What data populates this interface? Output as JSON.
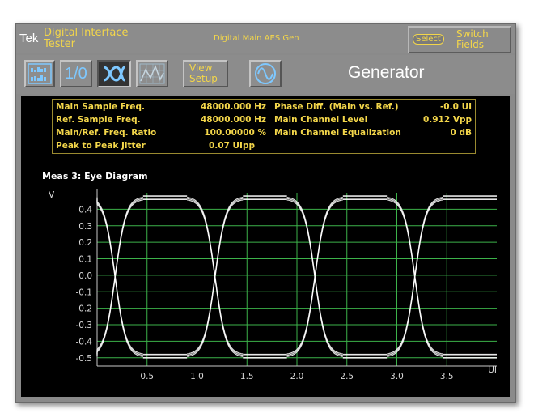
{
  "header": {
    "brand": "Tek",
    "app_title_line1": "Digital Interface",
    "app_title_line2": "Tester",
    "mode": "Digital Main AES Gen",
    "select_chip": "Select",
    "switch_line1": "Switch",
    "switch_line2": "Fields"
  },
  "toolbar": {
    "io_label": "1/0",
    "view_line1": "View",
    "view_line2": "Setup",
    "title": "Generator",
    "icons": [
      "bar-meter-icon",
      "io-icon",
      "eye-diagram-icon",
      "graph-icon",
      "view-setup",
      "sine-wave-icon"
    ]
  },
  "readout": {
    "rows": [
      {
        "label": "Main Sample Freq.",
        "value": "48000.000 Hz"
      },
      {
        "label": "Ref. Sample Freq.",
        "value": "48000.000 Hz"
      },
      {
        "label": "Main/Ref. Freq. Ratio",
        "value": "100.00000 %"
      },
      {
        "label": "Peak to Peak Jitter",
        "value": "0.07 UIpp"
      }
    ],
    "rows_right": [
      {
        "label": "Phase Diff. (Main vs. Ref.)",
        "value": "-0.0 UI"
      },
      {
        "label": "Main Channel Level",
        "value": "0.912 Vpp"
      },
      {
        "label": "Main Channel Equalization",
        "value": "0 dB"
      }
    ]
  },
  "measurement": {
    "title": "Meas 3: Eye Diagram"
  },
  "chart_data": {
    "type": "line",
    "title": "",
    "xlabel": "UI",
    "ylabel": "V",
    "xlim": [
      0,
      4
    ],
    "ylim": [
      -0.55,
      0.5
    ],
    "x_ticks": [
      0.5,
      1.0,
      1.5,
      2.0,
      2.5,
      3.0,
      3.5
    ],
    "y_ticks": [
      0.4,
      0.3,
      0.2,
      0.1,
      0.0,
      -0.1,
      -0.2,
      -0.3,
      -0.4,
      -0.5
    ],
    "grid": true,
    "levels": {
      "high": 0.47,
      "low": -0.49
    },
    "transition_centers": [
      0.18,
      1.18,
      2.18,
      3.18
    ],
    "transition_width_ui": 0.28,
    "trace_color": "#ffffff",
    "grid_color": "#3cb24a"
  },
  "colors": {
    "accent": "#f3d64a",
    "panel": "#8c8c8c",
    "screen": "#000000"
  }
}
